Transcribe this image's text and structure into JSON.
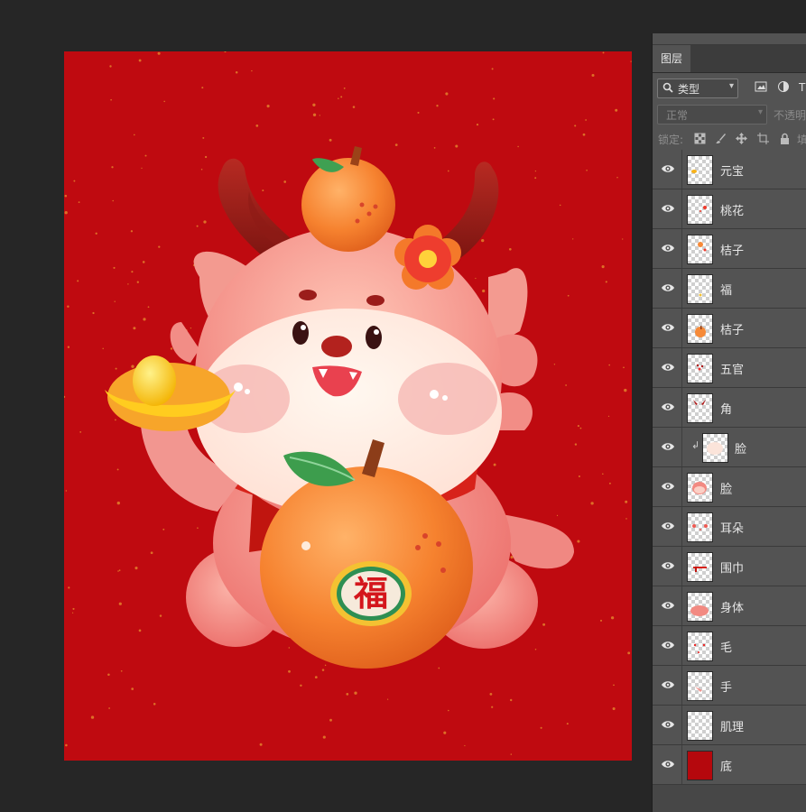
{
  "panel": {
    "tab_label": "图层",
    "filter": {
      "label": "类型",
      "icon": "search-icon"
    },
    "blend_mode": "正常",
    "opacity_label": "不透明度:",
    "lock_label": "锁定:",
    "fill_label": "填充:"
  },
  "layers": [
    {
      "name": "元宝",
      "visible": true,
      "thumb": "ingot"
    },
    {
      "name": "桃花",
      "visible": true,
      "thumb": "blossom"
    },
    {
      "name": "桔子",
      "visible": true,
      "thumb": "orange-small"
    },
    {
      "name": "福",
      "visible": true,
      "thumb": "dot-gold"
    },
    {
      "name": "桔子",
      "visible": true,
      "thumb": "orange-big"
    },
    {
      "name": "五官",
      "visible": true,
      "thumb": "face-features"
    },
    {
      "name": "角",
      "visible": true,
      "thumb": "horns"
    },
    {
      "name": "脸",
      "visible": true,
      "clipped": true,
      "thumb": "face-light"
    },
    {
      "name": "脸",
      "visible": true,
      "underline": true,
      "thumb": "face-pink"
    },
    {
      "name": "耳朵",
      "visible": true,
      "thumb": "ears"
    },
    {
      "name": "围巾",
      "visible": true,
      "thumb": "scarf"
    },
    {
      "name": "身体",
      "visible": true,
      "thumb": "body"
    },
    {
      "name": "毛",
      "visible": true,
      "thumb": "fur"
    },
    {
      "name": "手",
      "visible": true,
      "thumb": "hand"
    },
    {
      "name": "肌理",
      "visible": true,
      "thumb": "texture"
    },
    {
      "name": "底",
      "visible": true,
      "thumb": "base",
      "base": true
    }
  ],
  "artwork": {
    "badge_text": "福",
    "background_color": "#bf0a10"
  }
}
